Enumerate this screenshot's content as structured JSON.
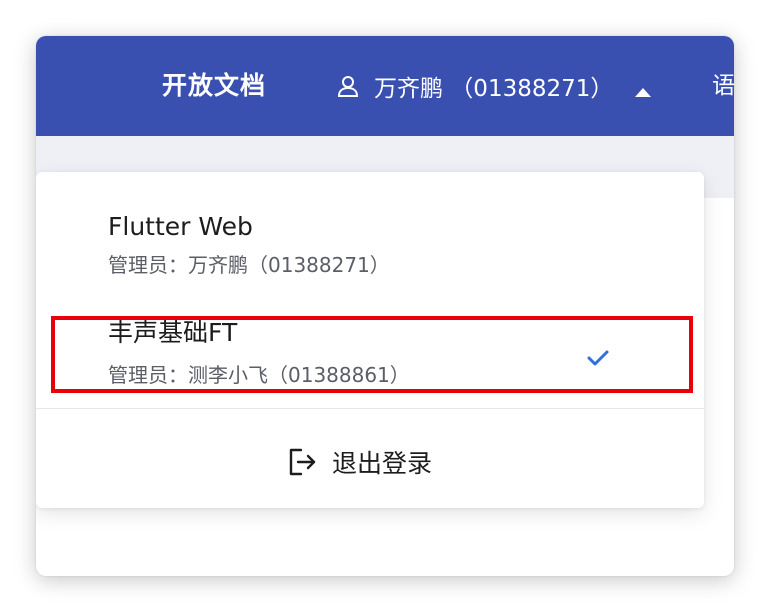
{
  "header": {
    "nav_link": "开放文档",
    "account_label": "万齐鹏 （01388271）",
    "lang_label": "语"
  },
  "dropdown": {
    "organizations": [
      {
        "name": "Flutter Web",
        "admin": "管理员：万齐鹏（01388271）",
        "selected": false
      },
      {
        "name": "丰声基础FT",
        "admin": "管理员：测李小飞（01388861）",
        "selected": true
      }
    ],
    "logout_label": "退出登录"
  },
  "colors": {
    "header_bg": "#3a50b0",
    "check": "#2f6fe0",
    "highlight": "#e8000b"
  },
  "icons": [
    "user-icon",
    "caret-up-icon",
    "check-icon",
    "logout-icon"
  ]
}
